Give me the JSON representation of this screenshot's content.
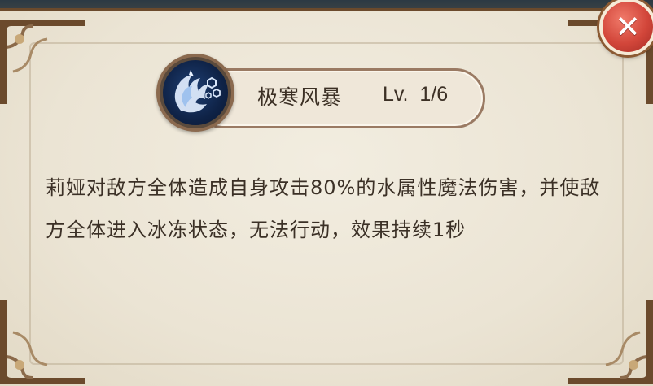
{
  "dialog": {
    "close_icon": "close-x-icon",
    "close_color": "#d2463a"
  },
  "skill": {
    "icon": "frost-storm-skill-icon",
    "name": "极寒风暴",
    "level": "Lv.  1/6",
    "description": "莉娅对敌方全体造成自身攻击80%的水属性魔法伤害，并使敌方全体进入冰冻状态，无法行动，效果持续1秒"
  },
  "colors": {
    "panel": "#ebe4d4",
    "frame": "#6b4a2c",
    "text": "#3b3026",
    "close": "#d2463a"
  }
}
